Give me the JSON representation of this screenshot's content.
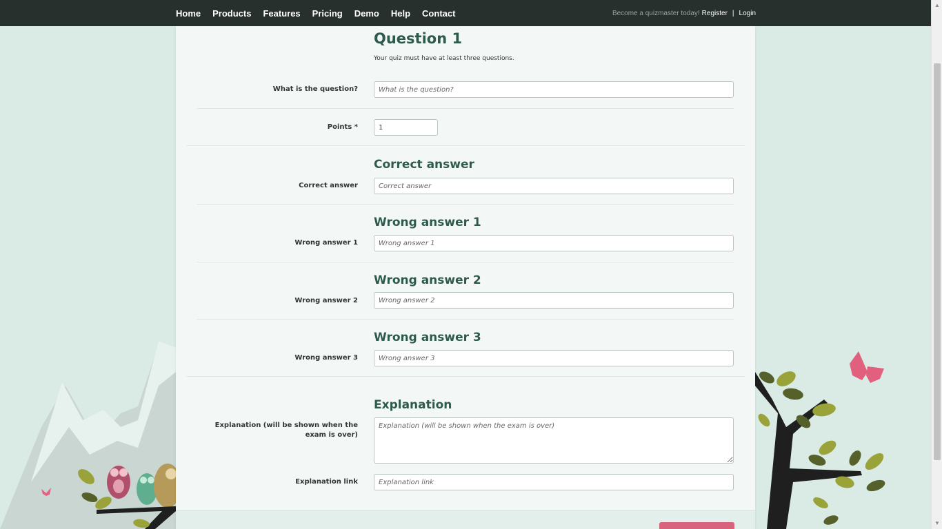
{
  "nav": {
    "items": [
      "Home",
      "Products",
      "Features",
      "Pricing",
      "Demo",
      "Help",
      "Contact"
    ],
    "promo": "Become a quizmaster today!",
    "register": "Register",
    "separator": "|",
    "login": "Login"
  },
  "question": {
    "title": "Question 1",
    "help": "Your quiz must have at least three questions.",
    "question_label": "What is the question?",
    "question_placeholder": "What is the question?",
    "points_label": "Points *",
    "points_value": "1"
  },
  "correct": {
    "title": "Correct answer",
    "label": "Correct answer",
    "placeholder": "Correct answer"
  },
  "wrong": [
    {
      "title": "Wrong answer 1",
      "label": "Wrong answer 1",
      "placeholder": "Wrong answer 1"
    },
    {
      "title": "Wrong answer 2",
      "label": "Wrong answer 2",
      "placeholder": "Wrong answer 2"
    },
    {
      "title": "Wrong answer 3",
      "label": "Wrong answer 3",
      "placeholder": "Wrong answer 3"
    }
  ],
  "explanation": {
    "title": "Explanation",
    "label": "Explanation (will be shown when the exam is over)",
    "placeholder": "Explanation (will be shown when the exam is over)",
    "link_label": "Explanation link",
    "link_placeholder": "Explanation link"
  },
  "colors": {
    "nav_bg": "#27302d",
    "heading": "#2e5a4d",
    "page_bg": "#d9ebe4",
    "button": "#d9637c"
  }
}
